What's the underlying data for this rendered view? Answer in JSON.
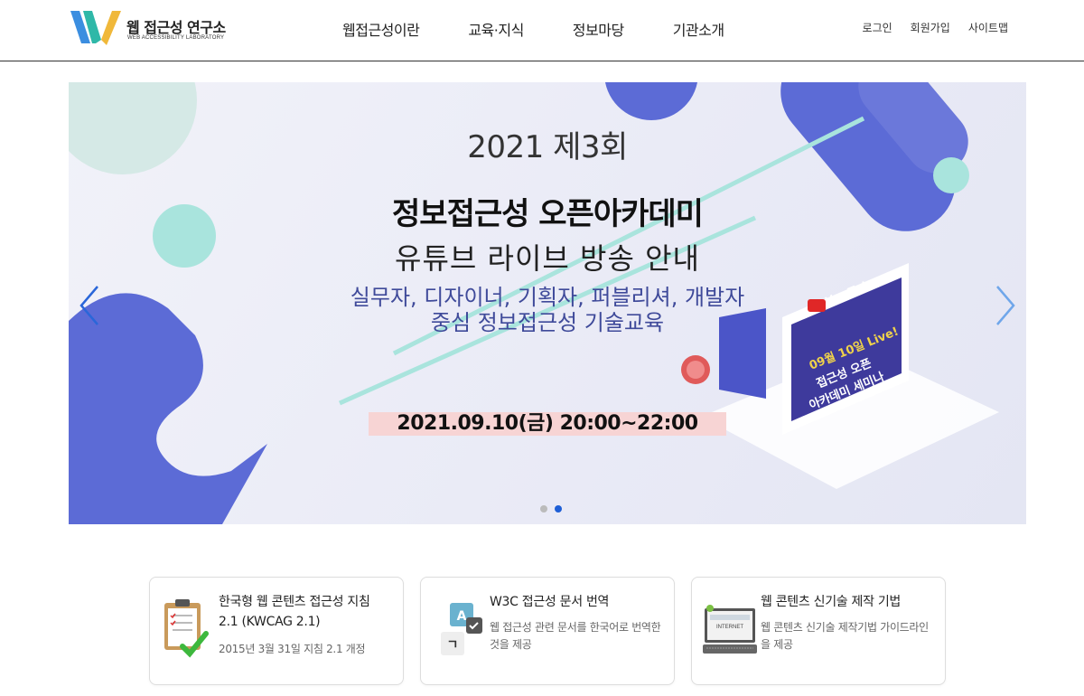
{
  "brand": {
    "title": "웹 접근성 연구소",
    "subtitle": "WEB ACCESSIBILITY LABORATORY",
    "colors": {
      "blue": "#3b8ee0",
      "teal": "#2fb8a8",
      "yellow": "#f0b83a"
    }
  },
  "nav": {
    "items": [
      "웹접근성이란",
      "교육·지식",
      "정보마당",
      "기관소개"
    ]
  },
  "util": {
    "login": "로그인",
    "signup": "회원가입",
    "sitemap": "사이트맵"
  },
  "banner": {
    "year": "2021 제3회",
    "title": "정보접근성 오픈아카데미",
    "title2": "유튜브 라이브 방송 안내",
    "sub1": "실무자, 디자이너, 기획자, 퍼블리셔, 개발자",
    "sub2": "중심 정보접근성 기술교육",
    "date": "2021.09.10(금) 20:00~22:00",
    "youtube_label": "YouTube",
    "screen_lines": [
      "09월 10일 Live!",
      "접근성 오픈",
      "아카데미 세미나"
    ],
    "slide_count": 2,
    "active_slide": 2,
    "colors": {
      "accent": "#5c6bd6",
      "mint": "#a9e4dd",
      "pink": "#f7d4d4"
    }
  },
  "cards": [
    {
      "icon": "checklist-icon",
      "title": "한국형 웹 콘텐츠 접근성 지침 2.1 (KWCAG 2.1)",
      "desc": "2015년 3월 31일 지침 2.1 개정"
    },
    {
      "icon": "translate-icon",
      "title": "W3C 접근성 문서 번역",
      "desc": "웹 접근성 관련 문서를 한국어로 번역한 것을 제공",
      "icon_letters": [
        "A",
        "ㄱ"
      ]
    },
    {
      "icon": "computer-icon",
      "title": "웹 콘텐츠 신기술 제작 기법",
      "desc": "웹 콘텐츠 신기술 제작기법 가이드라인을 제공",
      "icon_label": "INTERNET"
    }
  ]
}
